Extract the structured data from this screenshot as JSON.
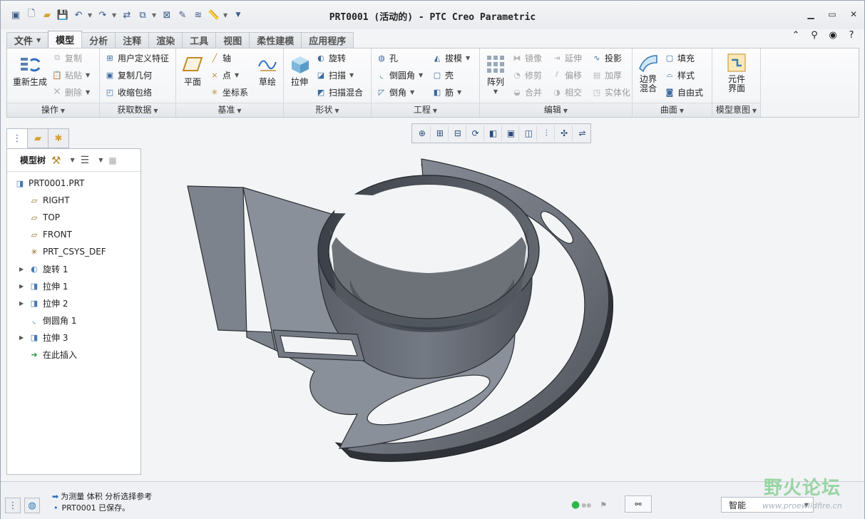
{
  "window": {
    "title": "PRT0001 (活动的) - PTC Creo Parametric"
  },
  "quick_access": [
    "new-icon",
    "open-icon",
    "save-icon",
    "undo-icon",
    "redo-icon",
    "regenerate-icon",
    "windows-icon",
    "close-icon"
  ],
  "tabs": [
    {
      "label": "文件"
    },
    {
      "label": "模型"
    },
    {
      "label": "分析"
    },
    {
      "label": "注释"
    },
    {
      "label": "渲染"
    },
    {
      "label": "工具"
    },
    {
      "label": "视图"
    },
    {
      "label": "柔性建模"
    },
    {
      "label": "应用程序"
    }
  ],
  "ribbon": {
    "operations": {
      "label": "操作",
      "regenerate": "重新生成",
      "copy": "复制",
      "paste": "粘贴",
      "delete": "删除"
    },
    "get_data": {
      "label": "获取数据",
      "udf": "用户定义特征",
      "copy_geom": "复制几何",
      "shrinkwrap": "收缩包络"
    },
    "datum": {
      "label": "基准",
      "plane": "平面",
      "axis": "轴",
      "point": "点",
      "csys": "坐标系",
      "sketch": "草绘"
    },
    "shapes": {
      "label": "形状",
      "extrude": "拉伸",
      "revolve": "旋转",
      "sweep": "扫描",
      "swept_blend": "扫描混合"
    },
    "engineering": {
      "label": "工程",
      "hole": "孔",
      "round": "倒圆角",
      "chamfer": "倒角",
      "draft": "拔模",
      "shell": "壳",
      "rib": "筋"
    },
    "editing": {
      "label": "编辑",
      "pattern": "阵列",
      "mirror": "镜像",
      "trim": "修剪",
      "merge": "合并",
      "extend": "延伸",
      "offset": "偏移",
      "intersect": "相交",
      "project": "投影",
      "thicken": "加厚",
      "solidify": "实体化"
    },
    "surfaces": {
      "label": "曲面",
      "boundary_blend": "边界混合",
      "fill": "填充",
      "style": "样式",
      "freestyle": "自由式"
    },
    "model_intent": {
      "label": "模型意图",
      "component_interface": "元件界面"
    }
  },
  "model_tree": {
    "label": "模型树",
    "root": "PRT0001.PRT",
    "items": [
      "RIGHT",
      "TOP",
      "FRONT",
      "PRT_CSYS_DEF",
      "旋转 1",
      "拉伸 1",
      "拉伸 2",
      "倒圆角 1",
      "拉伸 3",
      "在此插入"
    ]
  },
  "status": {
    "line1": "为测量 体积 分析选择参考",
    "line2": "PRT0001 已保存。",
    "filter": "智能"
  },
  "watermark": {
    "text": "野火论坛",
    "url": "www.proewildfire.cn"
  }
}
